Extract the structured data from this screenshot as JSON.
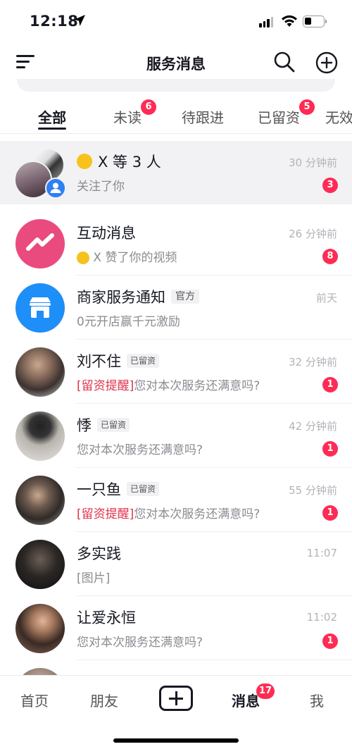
{
  "status_bar": {
    "time": "12:18"
  },
  "header": {
    "title": "服务消息"
  },
  "tabs": [
    {
      "label": "全部",
      "badge": ""
    },
    {
      "label": "未读",
      "badge": "6"
    },
    {
      "label": "待跟进",
      "badge": ""
    },
    {
      "label": "已留资",
      "badge": "5"
    },
    {
      "label": "无效",
      "badge": ""
    }
  ],
  "messages": [
    {
      "name": "X 等 3 人",
      "preview": "关注了你",
      "time": "30 分钟前",
      "count": "3"
    },
    {
      "name": "互动消息",
      "preview": "X 赞了你的视频",
      "time": "26 分钟前",
      "count": "8"
    },
    {
      "name": "商家服务通知",
      "tag": "官方",
      "preview": "0元开店赢千元激励",
      "time": "前天",
      "count": ""
    },
    {
      "name": "刘不住",
      "tag": "已留资",
      "preview_highlight": "[留资提醒]",
      "preview": "您对本次服务还满意吗?",
      "time": "32 分钟前",
      "count": "1"
    },
    {
      "name": "悸",
      "tag": "已留资",
      "preview": "您对本次服务还满意吗?",
      "time": "42 分钟前",
      "count": "1"
    },
    {
      "name": "一只鱼",
      "tag": "已留资",
      "preview_highlight": "[留资提醒]",
      "preview": "您对本次服务还满意吗?",
      "time": "55 分钟前",
      "count": "1"
    },
    {
      "name": "多实践",
      "preview": "[图片]",
      "time": "11:07",
      "count": ""
    },
    {
      "name": "让爱永恒",
      "preview": "您对本次服务还满意吗?",
      "time": "11:02",
      "count": "1"
    }
  ],
  "bottom_nav": {
    "home": "首页",
    "friends": "朋友",
    "messages": "消息",
    "messages_badge": "17",
    "me": "我"
  },
  "colors": {
    "accent_red": "#fe2c55",
    "interaction_pink": "#ea4b7f",
    "merchant_blue": "#1e8ef8"
  }
}
